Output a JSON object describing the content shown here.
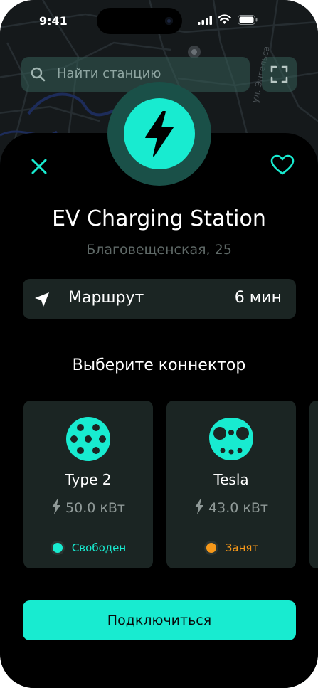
{
  "status_bar": {
    "time": "9:41"
  },
  "map": {
    "street_label": "ул. Энгельса"
  },
  "search": {
    "placeholder": "Найти станцию"
  },
  "station": {
    "name": "EV Charging Station",
    "address": "Благовещенская, 25"
  },
  "route": {
    "label": "Маршрут",
    "eta": "6 мин"
  },
  "connectors": {
    "heading": "Выберите коннектор",
    "items": [
      {
        "name": "Type 2",
        "power": "50.0 кВт",
        "status": "Свободен",
        "status_color": "#18ebd0",
        "icon": "type2-connector-icon"
      },
      {
        "name": "Tesla",
        "power": "43.0 кВт",
        "status": "Занят",
        "status_color": "#f5981a",
        "icon": "tesla-connector-icon"
      }
    ]
  },
  "actions": {
    "connect_label": "Подключиться"
  },
  "theme": {
    "accent": "#18ebd0",
    "background": "#000000",
    "card": "#1b2523",
    "busy": "#f5981a"
  }
}
